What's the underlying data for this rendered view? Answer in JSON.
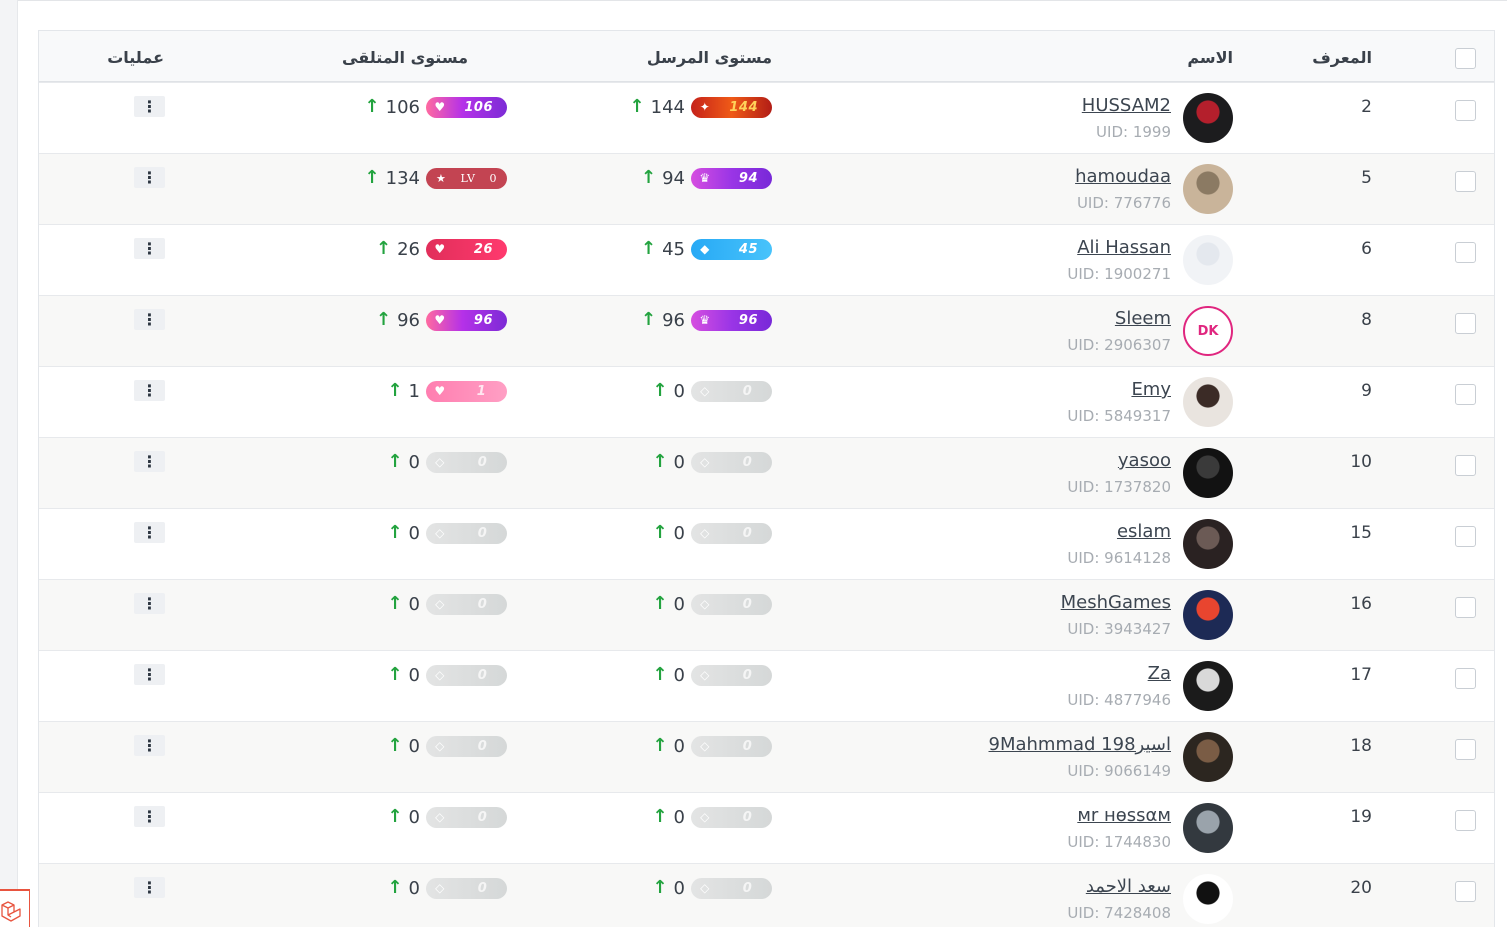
{
  "table": {
    "headers": {
      "id": "المعرف",
      "name": "الاسم",
      "sender_level": "مستوى المرسل",
      "receiver_level": "مستوى المتلقى",
      "actions": "عمليات"
    },
    "rows": [
      {
        "id": "2",
        "name": "HUSSAM2",
        "uid": "UID: 1999",
        "sender": "144",
        "sender_badge": "144",
        "sender_style": "orange",
        "receiver": "106",
        "receiver_badge": "106",
        "receiver_style": "purple",
        "avatar_color": "#1c1c1e",
        "avatar_accent": "#b41f2c"
      },
      {
        "id": "5",
        "name": "hamoudaa",
        "uid": "UID: 776776",
        "sender": "94",
        "sender_badge": "94",
        "sender_style": "purple2",
        "receiver": "134",
        "receiver_badge": "0",
        "receiver_style": "lv",
        "receiver_badge_prefix": "LV",
        "avatar_color": "#c9b49a",
        "avatar_accent": "#8b7a63"
      },
      {
        "id": "6",
        "name": "Ali Hassan",
        "uid": "UID: 1900271",
        "sender": "45",
        "sender_badge": "45",
        "sender_style": "blue",
        "receiver": "26",
        "receiver_badge": "26",
        "receiver_style": "red",
        "avatar_color": "#f1f3f6",
        "avatar_accent": "#e4e8ee"
      },
      {
        "id": "8",
        "name": "Sleem",
        "uid": "UID: 2906307",
        "sender": "96",
        "sender_badge": "96",
        "sender_style": "purple2",
        "receiver": "96",
        "receiver_badge": "96",
        "receiver_style": "purple",
        "avatar_color": "#ffffff",
        "avatar_accent": "#e0267f",
        "avatar_text": "DK"
      },
      {
        "id": "9",
        "name": "Emy",
        "uid": "UID: 5849317",
        "sender": "0",
        "sender_badge": "0",
        "sender_style": "grey",
        "receiver": "1",
        "receiver_badge": "1",
        "receiver_style": "pink",
        "avatar_color": "#e9e4df",
        "avatar_accent": "#3b2b26"
      },
      {
        "id": "10",
        "name": "yasoo",
        "uid": "UID: 1737820",
        "sender": "0",
        "sender_badge": "0",
        "sender_style": "grey",
        "receiver": "0",
        "receiver_badge": "0",
        "receiver_style": "grey",
        "avatar_color": "#121212",
        "avatar_accent": "#3a3a3a"
      },
      {
        "id": "15",
        "name": "eslam",
        "uid": "UID: 9614128",
        "sender": "0",
        "sender_badge": "0",
        "sender_style": "grey",
        "receiver": "0",
        "receiver_badge": "0",
        "receiver_style": "grey",
        "avatar_color": "#2a2222",
        "avatar_accent": "#6b5a55"
      },
      {
        "id": "16",
        "name": "MeshGames",
        "uid": "UID: 3943427",
        "sender": "0",
        "sender_badge": "0",
        "sender_style": "grey",
        "receiver": "0",
        "receiver_badge": "0",
        "receiver_style": "grey",
        "avatar_color": "#1d2a55",
        "avatar_accent": "#e8452f"
      },
      {
        "id": "17",
        "name": "Za",
        "uid": "UID: 4877946",
        "sender": "0",
        "sender_badge": "0",
        "sender_style": "grey",
        "receiver": "0",
        "receiver_badge": "0",
        "receiver_style": "grey",
        "avatar_color": "#1b1b1b",
        "avatar_accent": "#d9d9d9"
      },
      {
        "id": "18",
        "name": "اسير9Mahmmad 198",
        "uid": "UID: 9066149",
        "sender": "0",
        "sender_badge": "0",
        "sender_style": "grey",
        "receiver": "0",
        "receiver_badge": "0",
        "receiver_style": "grey",
        "avatar_color": "#2c2620",
        "avatar_accent": "#7a5c45"
      },
      {
        "id": "19",
        "name": "мr нѳssαм",
        "uid": "UID: 1744830",
        "sender": "0",
        "sender_badge": "0",
        "sender_style": "grey",
        "receiver": "0",
        "receiver_badge": "0",
        "receiver_style": "grey",
        "avatar_color": "#33393f",
        "avatar_accent": "#9aa3ab"
      },
      {
        "id": "20",
        "name": "سعد الاحمد",
        "uid": "UID: 7428408",
        "sender": "0",
        "sender_badge": "0",
        "sender_style": "grey",
        "receiver": "0",
        "receiver_badge": "0",
        "receiver_style": "grey",
        "avatar_color": "#ffffff",
        "avatar_accent": "#111111"
      }
    ]
  },
  "icons": {
    "level_arrow": "arrow-up-icon",
    "actions": "vertical-dots-icon",
    "corner_logo": "laravel-logo-icon"
  },
  "colors": {
    "arrow_up": "#23a33f",
    "accent_logo": "#e8543f"
  }
}
